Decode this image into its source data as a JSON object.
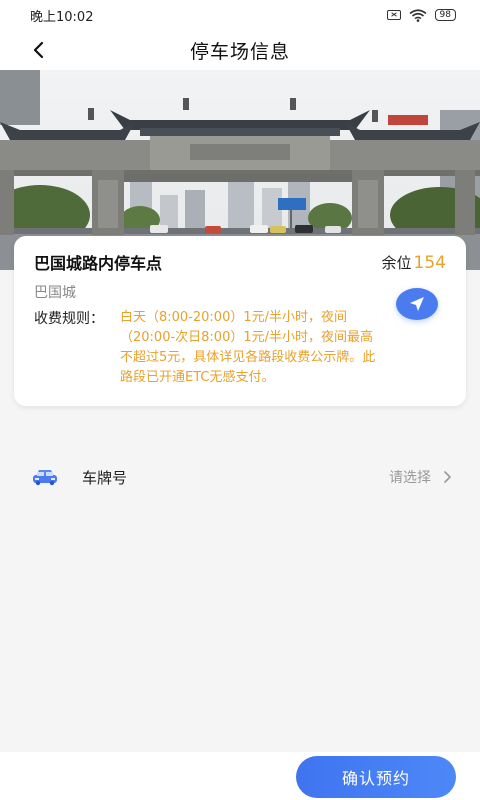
{
  "status_bar": {
    "time": "晚上10:02",
    "battery": "98"
  },
  "header": {
    "title": "停车场信息"
  },
  "lot": {
    "name": "巴国城路内停车点",
    "remain_label": "余位",
    "remain_count": "154",
    "area": "巴国城",
    "fee_label": "收费规则：",
    "fee_text": "白天（8:00-20:00）1元/半小时，夜间（20:00-次日8:00）1元/半小时，夜间最高不超过5元，具体详见各路段收费公示牌。此路段已开通ETC无感支付。"
  },
  "plate": {
    "label": "车牌号",
    "value": "请选择"
  },
  "actions": {
    "confirm_label": "确认预约"
  },
  "colors": {
    "accent": "#4a7cf0",
    "highlight": "#e8a12c"
  },
  "icons": [
    "back-icon",
    "navigate-icon",
    "car-icon",
    "chevron-right-icon",
    "wifi-icon",
    "battery-icon"
  ]
}
